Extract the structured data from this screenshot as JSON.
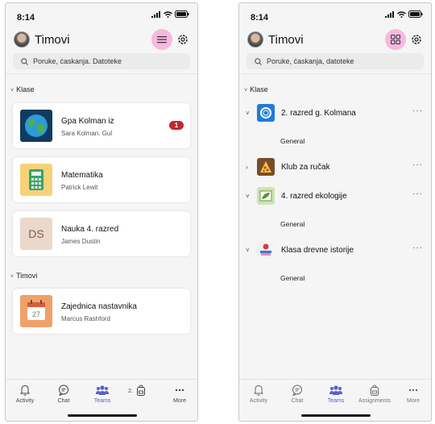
{
  "left": {
    "time": "8:14",
    "title": "Timovi",
    "search_placeholder": "Poruke, ćaskanja. Datoteke",
    "section_classes": "Klase",
    "section_teams": "Timovi",
    "classes": [
      {
        "name": "Gpa Kolman iz",
        "sub": "Sara Kolman. Gul",
        "badge": "1",
        "icon": "globe-icon"
      },
      {
        "name": "Matematika",
        "sub": "Patrick Lewit",
        "icon": "calculator-icon"
      },
      {
        "name": "Nauka 4. razred",
        "sub": "James Dustin",
        "initials": "DS"
      }
    ],
    "teams": [
      {
        "name": "Zajednica nastavnika",
        "sub": "Marcus Rashford",
        "icon": "calendar-icon",
        "calendar_day": "27"
      }
    ],
    "nav": [
      {
        "label": "Activity",
        "icon": "bell-icon"
      },
      {
        "label": "Chat",
        "icon": "chat-icon"
      },
      {
        "label": "Teams",
        "icon": "teams-icon",
        "active": true
      },
      {
        "label": "2.",
        "icon": "backpack-icon"
      },
      {
        "label": "More",
        "icon": "more-icon"
      }
    ]
  },
  "right": {
    "time": "8:14",
    "title": "Timovi",
    "search_placeholder": "Poruke, ćaskanja, datoteke",
    "section_classes": "Klase",
    "teams": [
      {
        "name": "2. razred g. Kolmana",
        "channel": "General",
        "expanded": true,
        "icon": "ring-icon"
      },
      {
        "name": "Klub za ručak",
        "expanded": false,
        "icon": "pizza-icon"
      },
      {
        "name": "4. razred ekologije",
        "channel": "General",
        "expanded": true,
        "icon": "leaf-icon"
      },
      {
        "name": "Klasa drevne istorije",
        "channel": "General",
        "expanded": true,
        "icon": "books-apple-icon"
      }
    ],
    "nav": [
      {
        "label": "Activity",
        "icon": "bell-icon"
      },
      {
        "label": "Chat",
        "icon": "chat-icon"
      },
      {
        "label": "Teams",
        "icon": "teams-icon",
        "active": true
      },
      {
        "label": "Assignments",
        "icon": "backpack-icon"
      },
      {
        "label": "More",
        "icon": "more-icon"
      }
    ]
  },
  "colors": {
    "accent": "#5b5fc7",
    "highlight": "#f8b8e0",
    "badge": "#c4262e"
  }
}
